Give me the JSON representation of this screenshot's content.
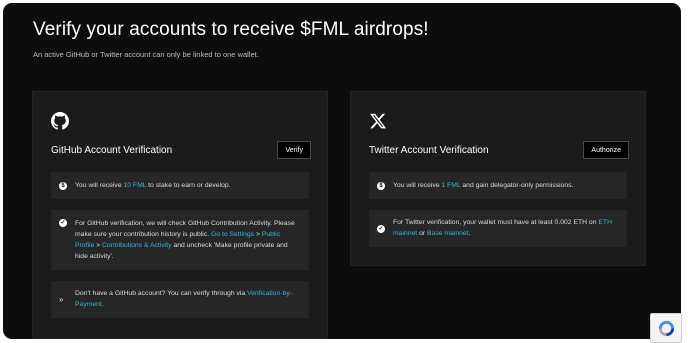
{
  "header": {
    "title": "Verify your accounts to receive $FML airdrops!",
    "subtitle": "An active GitHub or Twitter account can only be linked to one wallet."
  },
  "github": {
    "title": "GitHub Account Verification",
    "button": "Verify",
    "notes": [
      {
        "pre": "You will receive ",
        "link": "10 FML",
        "post": " to stake to earn or develop."
      },
      {
        "pre": "For GitHub verification, we will check GitHub Contribution Activity. Please make sure your contribution history is public. ",
        "link1": "Go to Settings",
        "sep1": " > ",
        "link2": "Public Profile",
        "sep2": " > ",
        "link3": "Contributions & Activity",
        "post": " and uncheck 'Make profile private and hide activity'."
      },
      {
        "pre": "Don't have a GitHub account? You can verify through via ",
        "link": "Verification-by-Payment",
        "post": "."
      }
    ]
  },
  "twitter": {
    "title": "Twitter Account Verification",
    "button": "Authorize",
    "notes": [
      {
        "pre": "You will receive ",
        "link": "1 FML",
        "post": " and gain delegator-only permissions."
      },
      {
        "pre": "For Twitter verification, your wallet must have at least 0.002 ETH on ",
        "link1": "ETH mainnet",
        "sep1": " or ",
        "link2": "Base mainnet",
        "post": "."
      }
    ]
  },
  "colors": {
    "background": "#0d0d0d",
    "card": "#1b1b1b",
    "note": "#262626",
    "link": "#3bb4d8"
  },
  "icons": [
    "github-icon",
    "x-icon",
    "dollar-circle-icon",
    "check-circle-icon",
    "double-chevron-right-icon",
    "recaptcha-icon"
  ]
}
